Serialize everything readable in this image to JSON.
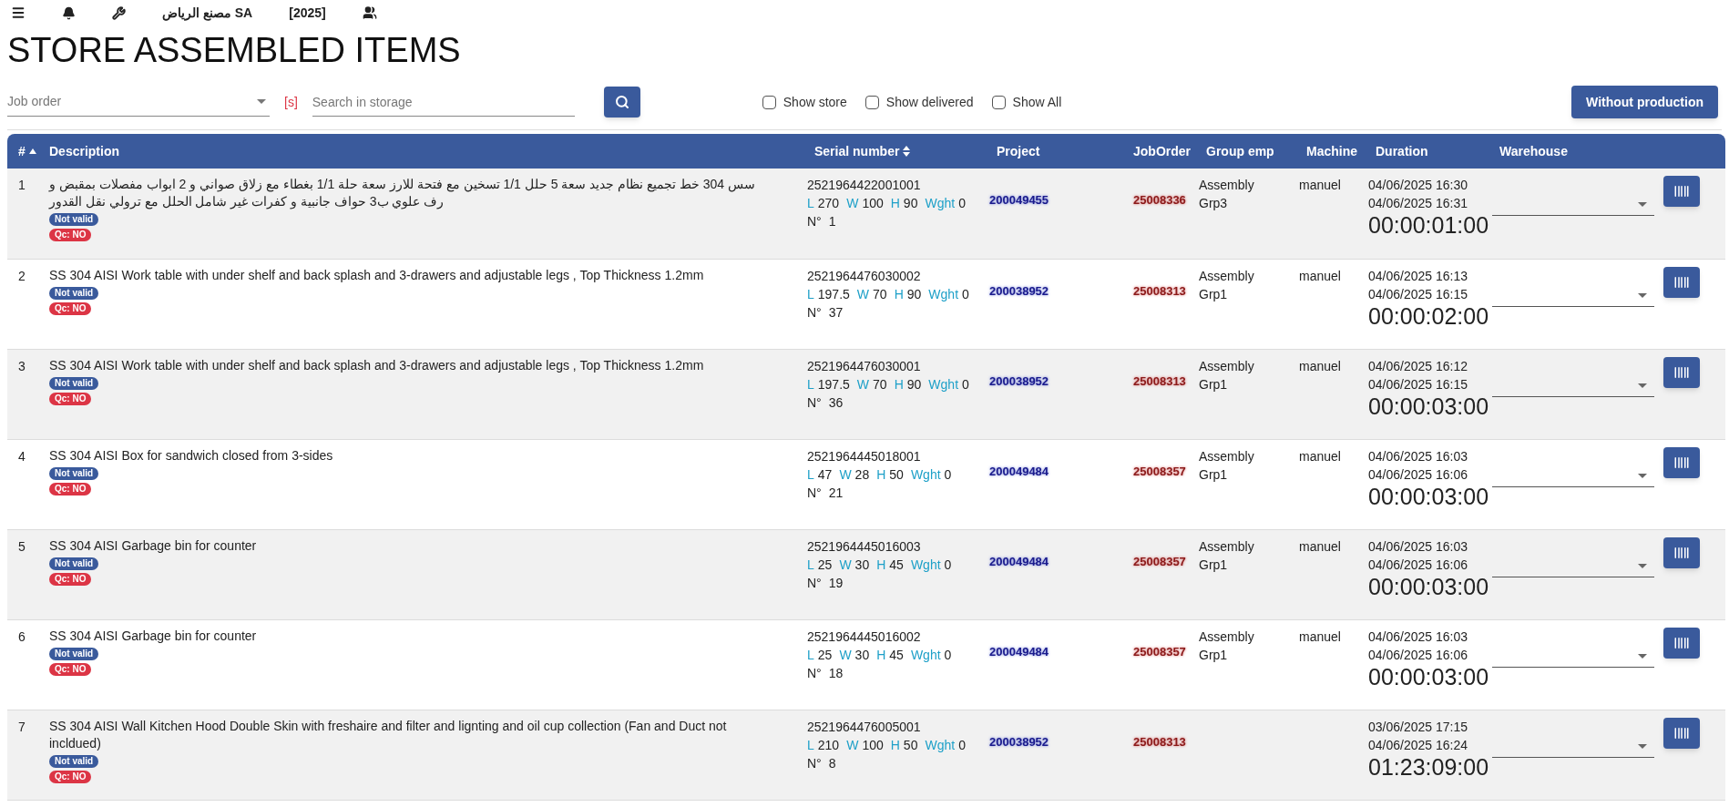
{
  "topbar": {
    "company": "مصنع الرياض SA",
    "year": "[2025]"
  },
  "title": "STORE ASSEMBLED ITEMS",
  "filters": {
    "job_order": {
      "placeholder": "Job order"
    },
    "shortcut": "[s]",
    "search": {
      "placeholder": "Search in storage"
    },
    "checkboxes": [
      {
        "label": "Show store",
        "checked": false
      },
      {
        "label": "Show delivered",
        "checked": false
      },
      {
        "label": "Show All",
        "checked": false
      }
    ],
    "action_button": "Without production"
  },
  "table": {
    "columns": [
      {
        "label": "#",
        "sorted_ascending": true,
        "sortable_toggle": false
      },
      {
        "label": "Description",
        "sorted_ascending": false,
        "sortable_toggle": false
      },
      {
        "label": "Serial number",
        "sorted_ascending": false,
        "sortable_toggle": true
      },
      {
        "label": "Project",
        "sorted_ascending": false,
        "sortable_toggle": false
      },
      {
        "label": "JobOrder",
        "sorted_ascending": false,
        "sortable_toggle": false
      },
      {
        "label": "Group emp",
        "sorted_ascending": false,
        "sortable_toggle": false
      },
      {
        "label": "Machine",
        "sorted_ascending": false,
        "sortable_toggle": false
      },
      {
        "label": "Duration",
        "sorted_ascending": false,
        "sortable_toggle": false
      },
      {
        "label": "Warehouse",
        "sorted_ascending": false,
        "sortable_toggle": false
      }
    ],
    "rows": [
      {
        "index": "1",
        "description": "سس 304 خط تجميع نظام جديد سعة 5 حلل 1/1 تسخين مع فتحة للارز سعة حلة 1/1 بغطاء مع زلاق صواني و 2 ابواب مفصلات بمقبض و رف علوي ب3 حواف جانبية و كفرات غير شامل الحلل مع ترولي نقل القدور",
        "badges": [
          {
            "text": "Not valid",
            "color": "#3a5a9c"
          },
          {
            "text": "Qc: NO",
            "color": "#dc3545"
          }
        ],
        "serial": "2521964422001001",
        "dims": [
          {
            "label": "L",
            "value": "270"
          },
          {
            "label": "W",
            "value": "100"
          },
          {
            "label": "H",
            "value": "90"
          },
          {
            "label": "Wght",
            "value": "0"
          }
        ],
        "n_label": "N°",
        "n": "1",
        "project": "200049455",
        "job_order": "25008336",
        "group_emp": "Assembly Grp3",
        "machine": "manuel",
        "start": "04/06/2025 16:30",
        "end": "04/06/2025 16:31",
        "duration": "00:00:01:00"
      },
      {
        "index": "2",
        "description": "SS 304 AISI Work table with under shelf and back splash and 3-drawers and adjustable legs , Top Thickness 1.2mm",
        "badges": [
          {
            "text": "Not valid",
            "color": "#3a5a9c"
          },
          {
            "text": "Qc: NO",
            "color": "#dc3545"
          }
        ],
        "serial": "2521964476030002",
        "dims": [
          {
            "label": "L",
            "value": "197.5"
          },
          {
            "label": "W",
            "value": "70"
          },
          {
            "label": "H",
            "value": "90"
          },
          {
            "label": "Wght",
            "value": "0"
          }
        ],
        "n_label": "N°",
        "n": "37",
        "project": "200038952",
        "job_order": "25008313",
        "group_emp": "Assembly Grp1",
        "machine": "manuel",
        "start": "04/06/2025 16:13",
        "end": "04/06/2025 16:15",
        "duration": "00:00:02:00"
      },
      {
        "index": "3",
        "description": "SS 304 AISI Work table with under shelf and back splash and 3-drawers and adjustable legs , Top Thickness 1.2mm",
        "badges": [
          {
            "text": "Not valid",
            "color": "#3a5a9c"
          },
          {
            "text": "Qc: NO",
            "color": "#dc3545"
          }
        ],
        "serial": "2521964476030001",
        "dims": [
          {
            "label": "L",
            "value": "197.5"
          },
          {
            "label": "W",
            "value": "70"
          },
          {
            "label": "H",
            "value": "90"
          },
          {
            "label": "Wght",
            "value": "0"
          }
        ],
        "n_label": "N°",
        "n": "36",
        "project": "200038952",
        "job_order": "25008313",
        "group_emp": "Assembly Grp1",
        "machine": "manuel",
        "start": "04/06/2025 16:12",
        "end": "04/06/2025 16:15",
        "duration": "00:00:03:00"
      },
      {
        "index": "4",
        "description": "SS 304 AISI Box for sandwich closed from 3-sides",
        "badges": [
          {
            "text": "Not valid",
            "color": "#3a5a9c"
          },
          {
            "text": "Qc: NO",
            "color": "#dc3545"
          }
        ],
        "serial": "2521964445018001",
        "dims": [
          {
            "label": "L",
            "value": "47"
          },
          {
            "label": "W",
            "value": "28"
          },
          {
            "label": "H",
            "value": "50"
          },
          {
            "label": "Wght",
            "value": "0"
          }
        ],
        "n_label": "N°",
        "n": "21",
        "project": "200049484",
        "job_order": "25008357",
        "group_emp": "Assembly Grp1",
        "machine": "manuel",
        "start": "04/06/2025 16:03",
        "end": "04/06/2025 16:06",
        "duration": "00:00:03:00"
      },
      {
        "index": "5",
        "description": "SS 304 AISI Garbage bin for counter",
        "badges": [
          {
            "text": "Not valid",
            "color": "#3a5a9c"
          },
          {
            "text": "Qc: NO",
            "color": "#dc3545"
          }
        ],
        "serial": "2521964445016003",
        "dims": [
          {
            "label": "L",
            "value": "25"
          },
          {
            "label": "W",
            "value": "30"
          },
          {
            "label": "H",
            "value": "45"
          },
          {
            "label": "Wght",
            "value": "0"
          }
        ],
        "n_label": "N°",
        "n": "19",
        "project": "200049484",
        "job_order": "25008357",
        "group_emp": "Assembly Grp1",
        "machine": "manuel",
        "start": "04/06/2025 16:03",
        "end": "04/06/2025 16:06",
        "duration": "00:00:03:00"
      },
      {
        "index": "6",
        "description": "SS 304 AISI Garbage bin for counter",
        "badges": [
          {
            "text": "Not valid",
            "color": "#3a5a9c"
          },
          {
            "text": "Qc: NO",
            "color": "#dc3545"
          }
        ],
        "serial": "2521964445016002",
        "dims": [
          {
            "label": "L",
            "value": "25"
          },
          {
            "label": "W",
            "value": "30"
          },
          {
            "label": "H",
            "value": "45"
          },
          {
            "label": "Wght",
            "value": "0"
          }
        ],
        "n_label": "N°",
        "n": "18",
        "project": "200049484",
        "job_order": "25008357",
        "group_emp": "Assembly Grp1",
        "machine": "manuel",
        "start": "04/06/2025 16:03",
        "end": "04/06/2025 16:06",
        "duration": "00:00:03:00"
      },
      {
        "index": "7",
        "description": "SS 304 AISI Wall Kitchen Hood Double Skin with freshaire and filter and lignting and oil cup collection (Fan and Duct not incldued)",
        "badges": [
          {
            "text": "Not valid",
            "color": "#3a5a9c"
          },
          {
            "text": "Qc: NO",
            "color": "#dc3545"
          }
        ],
        "serial": "2521964476005001",
        "dims": [
          {
            "label": "L",
            "value": "210"
          },
          {
            "label": "W",
            "value": "100"
          },
          {
            "label": "H",
            "value": "50"
          },
          {
            "label": "Wght",
            "value": "0"
          }
        ],
        "n_label": "N°",
        "n": "8",
        "project": "200038952",
        "job_order": "25008313",
        "start": "03/06/2025 17:15",
        "end": "04/06/2025 16:24",
        "duration": "01:23:09:00"
      }
    ]
  }
}
